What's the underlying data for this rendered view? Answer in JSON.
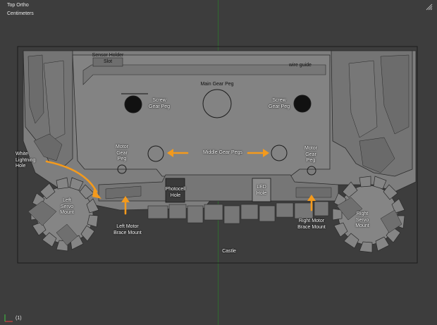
{
  "hud": {
    "view_name": "Top Ortho",
    "units": "Centimeters",
    "frame": "(1)"
  },
  "labels": {
    "sensor_holder_slot": "Sensor Holder\nSlot",
    "wire_guide": "wire guide",
    "main_gear_peg": "Main Gear Peg",
    "screw_gear_peg_left": "Screw\nGear Peg",
    "screw_gear_peg_right": "Screw\nGear Peg",
    "motor_gear_peg_left": "Motor\nGear\nPeg",
    "motor_gear_peg_right": "Motor\nGear\nPeg",
    "middle_gear_pegs": "Middle Gear Pegs",
    "white_lightning_hole": "White\nLightning\nHole",
    "photocell_hole": "Photocell\nHole",
    "led_hole": "LED\nHole",
    "left_servo_mount": "Left\nServo\nMount",
    "right_servo_mount": "Right\nServo\nMount",
    "left_motor_brace_mount": "Left Motor\nBrace Mount",
    "right_motor_brace_mount": "Right Motor\nBrace Mount",
    "castle": "Castle"
  },
  "icons": {
    "viewport_corner": "split-view-icon",
    "axis": "axis-gizmo-icon"
  },
  "colors": {
    "background": "#3d3d3d",
    "mesh_fill": "#7d7d7d",
    "mesh_edge": "#2a2a2a",
    "arrow": "#f39a1d",
    "y_axis": "#2f6a2f"
  }
}
